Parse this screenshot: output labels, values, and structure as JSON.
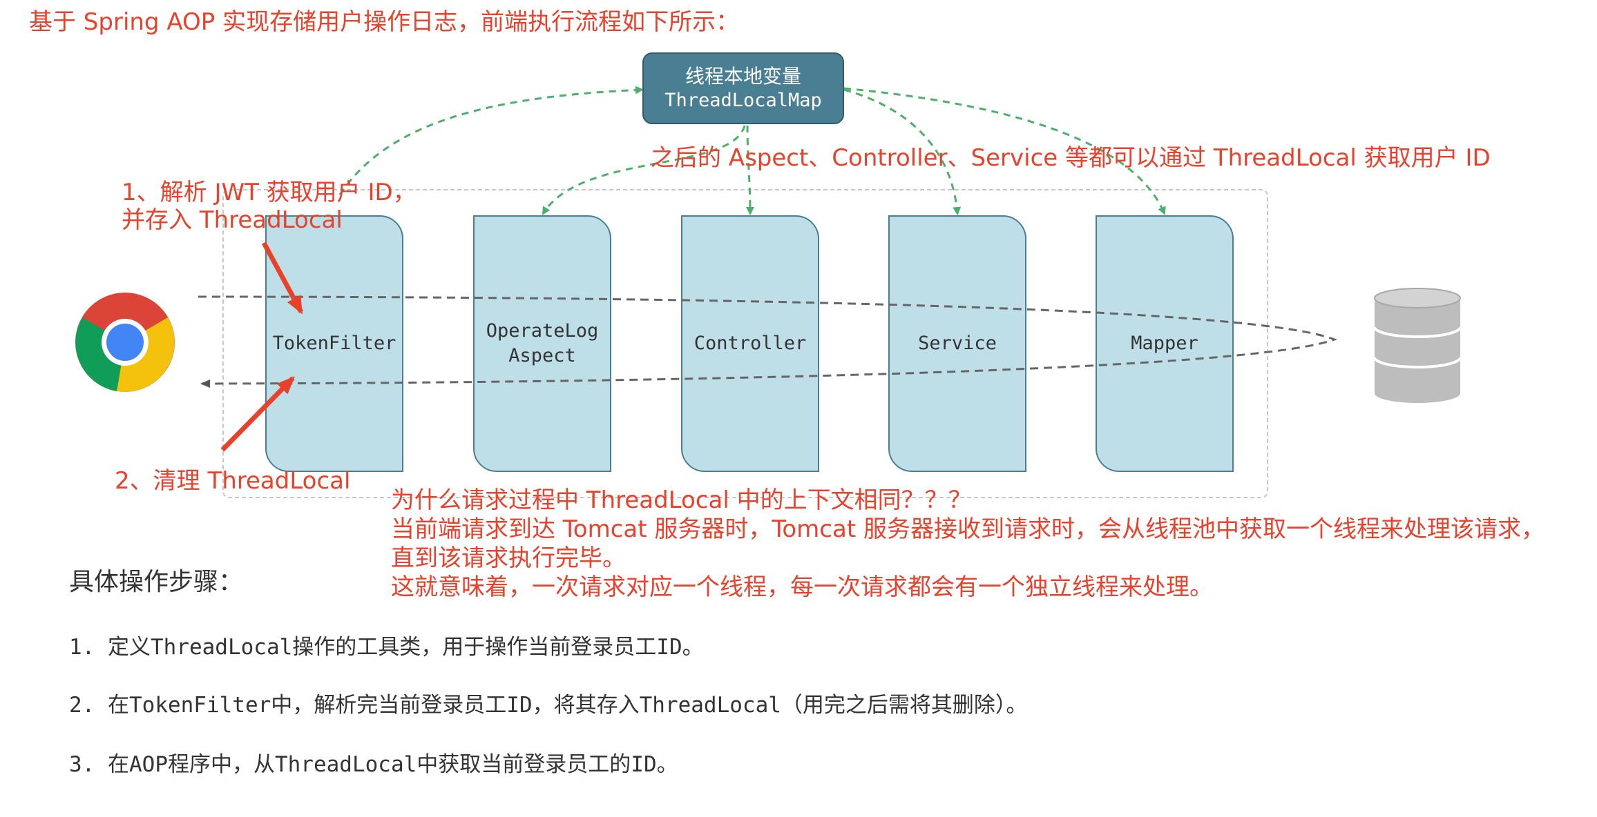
{
  "title": "基于 Spring AOP 实现存储用户操作日志，前端执行流程如下所示：",
  "thread_local_map": {
    "line1": "线程本地变量",
    "line2": "ThreadLocalMap"
  },
  "annotations": {
    "aspect_note": "之后的 Aspect、Controller、Service 等都可以通过 ThreadLocal 获取用户 ID",
    "parse_jwt_line1": "1、解析 JWT 获取用户 ID，",
    "parse_jwt_line2": "并存入 ThreadLocal",
    "clear_thread_local": "2、清理 ThreadLocal"
  },
  "components": [
    {
      "label": "TokenFilter"
    },
    {
      "label": "OperateLog\nAspect"
    },
    {
      "label": "Controller"
    },
    {
      "label": "Service"
    },
    {
      "label": "Mapper"
    }
  ],
  "explanation": {
    "line1": "为什么请求过程中 ThreadLocal 中的上下文相同？？？",
    "line2": "当前端请求到达 Tomcat 服务器时，Tomcat 服务器接收到请求时，会从线程池中获取一个线程来处理该请求，",
    "line3": "直到该请求执行完毕。",
    "line4": "这就意味着，一次请求对应一个线程，每一次请求都会有一个独立线程来处理。"
  },
  "steps_title": "具体操作步骤：",
  "steps": [
    "1. 定义ThreadLocal操作的工具类，用于操作当前登录员工ID。",
    "2. 在TokenFilter中，解析完当前登录员工ID，将其存入ThreadLocal（用完之后需将其删除）。",
    "3. 在AOP程序中，从ThreadLocal中获取当前登录员工的ID。"
  ],
  "colors": {
    "annotation_red": "#e8412c",
    "component_fill": "#bedfe8",
    "map_box_fill": "#4a7e92",
    "green_arrow": "#4caf6a"
  },
  "icons": [
    "chrome-browser-icon",
    "database-icon"
  ]
}
